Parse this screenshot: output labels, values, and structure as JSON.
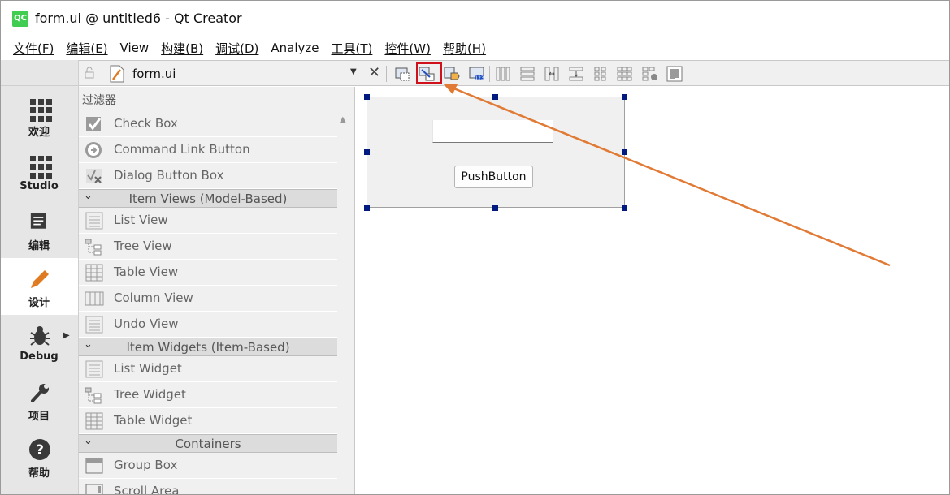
{
  "window": {
    "logo": "QC",
    "title": "form.ui @ untitled6 - Qt Creator"
  },
  "menubar": {
    "items": [
      "文件(F)",
      "编辑(E)",
      "View",
      "构建(B)",
      "调试(D)",
      "Analyze",
      "工具(T)",
      "控件(W)",
      "帮助(H)"
    ]
  },
  "modebar": {
    "modes": [
      {
        "label": "欢迎",
        "icon": "grid-icon"
      },
      {
        "label": "Studio",
        "icon": "grid-icon"
      },
      {
        "label": "编辑",
        "icon": "document-icon"
      },
      {
        "label": "设计",
        "icon": "pencil-icon",
        "active": true
      },
      {
        "label": "Debug",
        "icon": "bug-icon"
      },
      {
        "label": "项目",
        "icon": "wrench-icon"
      },
      {
        "label": "帮助",
        "icon": "help-icon"
      }
    ]
  },
  "editor_toolbar": {
    "file_name": "form.ui"
  },
  "widget_box": {
    "filter_label": "过滤器",
    "items": {
      "check_box": "Check Box",
      "command_link_button": "Command Link Button",
      "dialog_button_box": "Dialog Button Box",
      "cat_item_views": "Item Views (Model-Based)",
      "list_view": "List View",
      "tree_view": "Tree View",
      "table_view": "Table View",
      "column_view": "Column View",
      "undo_view": "Undo View",
      "cat_item_widgets": "Item Widgets (Item-Based)",
      "list_widget": "List Widget",
      "tree_widget": "Tree Widget",
      "table_widget": "Table Widget",
      "cat_containers": "Containers",
      "group_box": "Group Box",
      "scroll_area": "Scroll Area"
    }
  },
  "form": {
    "push_button_text": "PushButton"
  },
  "colors": {
    "highlight": "#d0101a",
    "arrow": "#e07a35",
    "handle": "#001a80",
    "qt_green": "#41cd52"
  }
}
